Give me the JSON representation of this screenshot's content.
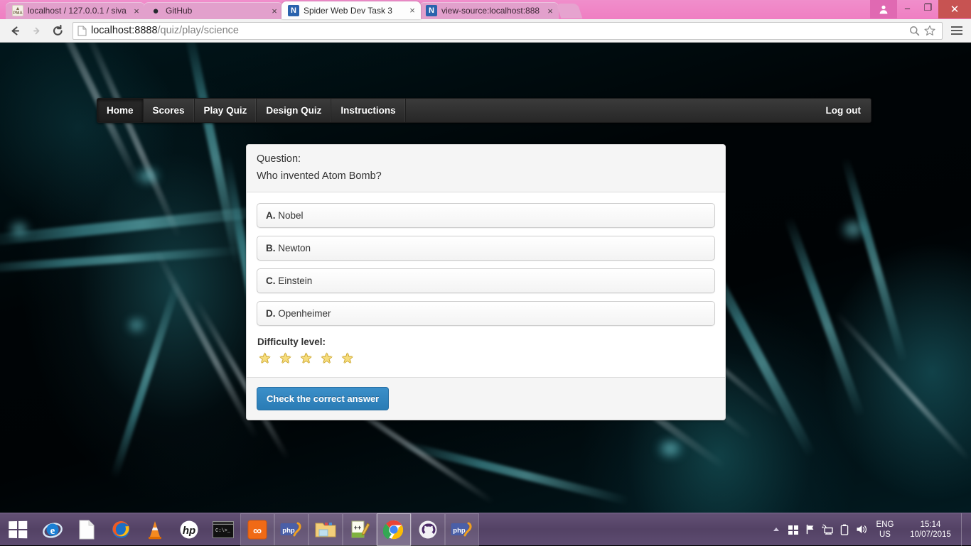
{
  "browser": {
    "tabs": [
      {
        "title": "localhost / 127.0.0.1 / siva",
        "favicon": "phpmyadmin-icon",
        "active": false,
        "close_label": "×"
      },
      {
        "title": "GitHub",
        "favicon": "github-icon",
        "active": false,
        "close_label": "×"
      },
      {
        "title": "Spider Web Dev Task 3",
        "favicon": "notepadpp-icon",
        "active": true,
        "close_label": "×"
      },
      {
        "title": "view-source:localhost:888",
        "favicon": "notepadpp-icon",
        "active": false,
        "close_label": "×"
      }
    ],
    "window_controls": {
      "avatar": "user-avatar-icon",
      "minimize": "–",
      "maximize": "❐",
      "close": "✕"
    },
    "toolbar": {
      "back": "←",
      "forward": "→",
      "reload": "⟳",
      "url_domain": "localhost:8888",
      "url_path": "/quiz/play/science",
      "url_full": "localhost:8888/quiz/play/science",
      "zoom_icon": "search-icon",
      "bookmark_icon": "star-icon",
      "menu_icon": "hamburger-menu-icon"
    }
  },
  "site_nav": {
    "items": [
      {
        "label": "Home",
        "active": true
      },
      {
        "label": "Scores",
        "active": false
      },
      {
        "label": "Play Quiz",
        "active": false
      },
      {
        "label": "Design Quiz",
        "active": false
      },
      {
        "label": "Instructions",
        "active": false
      }
    ],
    "logout_label": "Log out"
  },
  "quiz": {
    "question_label": "Question:",
    "question_text": "Who invented Atom Bomb?",
    "options": [
      {
        "letter": "A.",
        "text": "Nobel"
      },
      {
        "letter": "B.",
        "text": "Newton"
      },
      {
        "letter": "C.",
        "text": "Einstein"
      },
      {
        "letter": "D.",
        "text": "Openheimer"
      }
    ],
    "difficulty_label": "Difficulty level:",
    "difficulty_stars_total": 5,
    "difficulty_stars_filled": 5,
    "star_glyph": "★",
    "check_button_label": "Check the correct answer",
    "accent_button_color": "#2a7cb5",
    "star_color": "#f6dd7e"
  },
  "taskbar": {
    "start_label": "start-button",
    "items": [
      {
        "name": "internet-explorer-icon",
        "glyph": "e",
        "state": ""
      },
      {
        "name": "document-icon",
        "glyph": "▧",
        "state": ""
      },
      {
        "name": "firefox-icon",
        "glyph": "●",
        "state": ""
      },
      {
        "name": "vlc-icon",
        "glyph": "▲",
        "state": ""
      },
      {
        "name": "hp-support-icon",
        "glyph": "hp",
        "state": ""
      },
      {
        "name": "command-prompt-icon",
        "glyph": "C:\\>",
        "state": ""
      },
      {
        "name": "xampp-icon",
        "glyph": "∞",
        "state": "open"
      },
      {
        "name": "php-icon",
        "glyph": "php",
        "state": "open"
      },
      {
        "name": "file-explorer-icon",
        "glyph": "▱",
        "state": "open"
      },
      {
        "name": "notepadpp-icon",
        "glyph": "✎",
        "state": "open"
      },
      {
        "name": "google-chrome-icon",
        "glyph": "◉",
        "state": "focused"
      },
      {
        "name": "github-desktop-icon",
        "glyph": "●",
        "state": "open"
      },
      {
        "name": "phpstorm-icon",
        "glyph": "php",
        "state": "open"
      }
    ],
    "tray": {
      "show_hidden": "▲",
      "icons": [
        {
          "name": "windows-action-center-icon",
          "glyph": "⊞"
        },
        {
          "name": "flag-icon",
          "glyph": "⚑"
        },
        {
          "name": "network-icon",
          "glyph": "⎙"
        },
        {
          "name": "battery-icon",
          "glyph": "▯"
        },
        {
          "name": "volume-icon",
          "glyph": "🔊"
        }
      ],
      "language_primary": "ENG",
      "language_secondary": "US",
      "time": "15:14",
      "date": "10/07/2015"
    }
  }
}
